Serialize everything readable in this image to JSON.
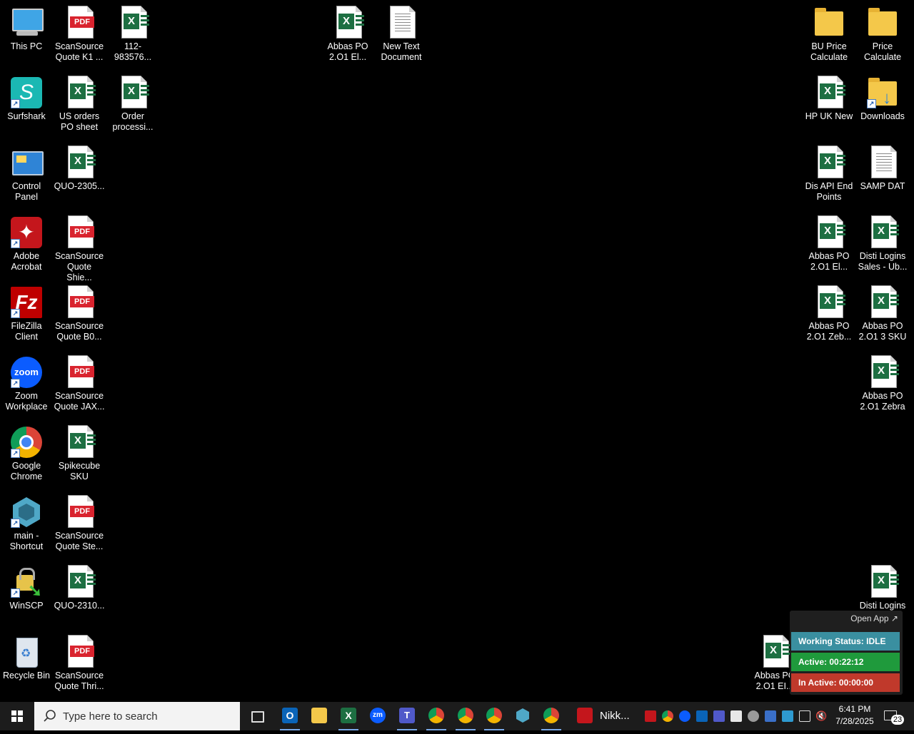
{
  "desktop": {
    "icons": [
      {
        "label": "This PC",
        "type": "pc"
      },
      {
        "label": "ScanSource Quote K1 ...",
        "type": "pdf"
      },
      {
        "label": "112-983576...",
        "type": "xlsx"
      },
      {
        "label": "Abbas PO 2.O1  El...",
        "type": "xlsx"
      },
      {
        "label": "New Text Document",
        "type": "txt"
      },
      {
        "label": "BU Price Calculate",
        "type": "folder"
      },
      {
        "label": "Price Calculate",
        "type": "folder"
      },
      {
        "label": "Surfshark",
        "type": "app"
      },
      {
        "label": "US orders PO sheet",
        "type": "xlsx"
      },
      {
        "label": "Order processi...",
        "type": "xlsx"
      },
      {
        "label": "HP UK New",
        "type": "xlsx"
      },
      {
        "label": "Downloads",
        "type": "folder"
      },
      {
        "label": "Control Panel",
        "type": "app"
      },
      {
        "label": "QUO-2305...",
        "type": "xlsx"
      },
      {
        "label": "Dis API End Points",
        "type": "xlsx"
      },
      {
        "label": "SAMP DAT",
        "type": "txt"
      },
      {
        "label": "Adobe Acrobat",
        "type": "app"
      },
      {
        "label": "ScanSource Quote Shie...",
        "type": "pdf"
      },
      {
        "label": "Abbas PO 2.O1  El...",
        "type": "xlsx"
      },
      {
        "label": "Disti Logins Sales - Ub...",
        "type": "xlsx"
      },
      {
        "label": "FileZilla Client",
        "type": "app"
      },
      {
        "label": "ScanSource Quote B0...",
        "type": "pdf"
      },
      {
        "label": "Abbas PO 2.O1  Zeb...",
        "type": "xlsx"
      },
      {
        "label": "Abbas PO 2.O1 3 SKU",
        "type": "xlsx"
      },
      {
        "label": "Zoom Workplace",
        "type": "app"
      },
      {
        "label": "ScanSource Quote JAX...",
        "type": "pdf"
      },
      {
        "label": "Abbas PO 2.O1 Zebra",
        "type": "xlsx"
      },
      {
        "label": "Google Chrome",
        "type": "app"
      },
      {
        "label": "Spikecube SKU",
        "type": "xlsx"
      },
      {
        "label": "main - Shortcut",
        "type": "app"
      },
      {
        "label": "ScanSource Quote Ste...",
        "type": "pdf"
      },
      {
        "label": "WinSCP",
        "type": "app"
      },
      {
        "label": "QUO-2310...",
        "type": "xlsx"
      },
      {
        "label": "Disti Logins",
        "type": "xlsx"
      },
      {
        "label": "Recycle Bin",
        "type": "app"
      },
      {
        "label": "ScanSource Quote Thri...",
        "type": "pdf"
      },
      {
        "label": "Abbas PO 2.O1  EI...",
        "type": "xlsx"
      }
    ]
  },
  "widget": {
    "open_app": "Open App ↗",
    "status": "Working Status: IDLE",
    "active": "Active: 00:22:12",
    "inactive": "In Active: 00:00:00",
    "colors": {
      "status": "#3a8fa0",
      "active": "#1f9a3c",
      "inactive": "#c0392b"
    }
  },
  "taskbar": {
    "search_placeholder": "Type here to search",
    "running_app_label": "Nikk...",
    "clock_time": "6:41 PM",
    "clock_date": "7/28/2025",
    "notification_count": "23"
  }
}
